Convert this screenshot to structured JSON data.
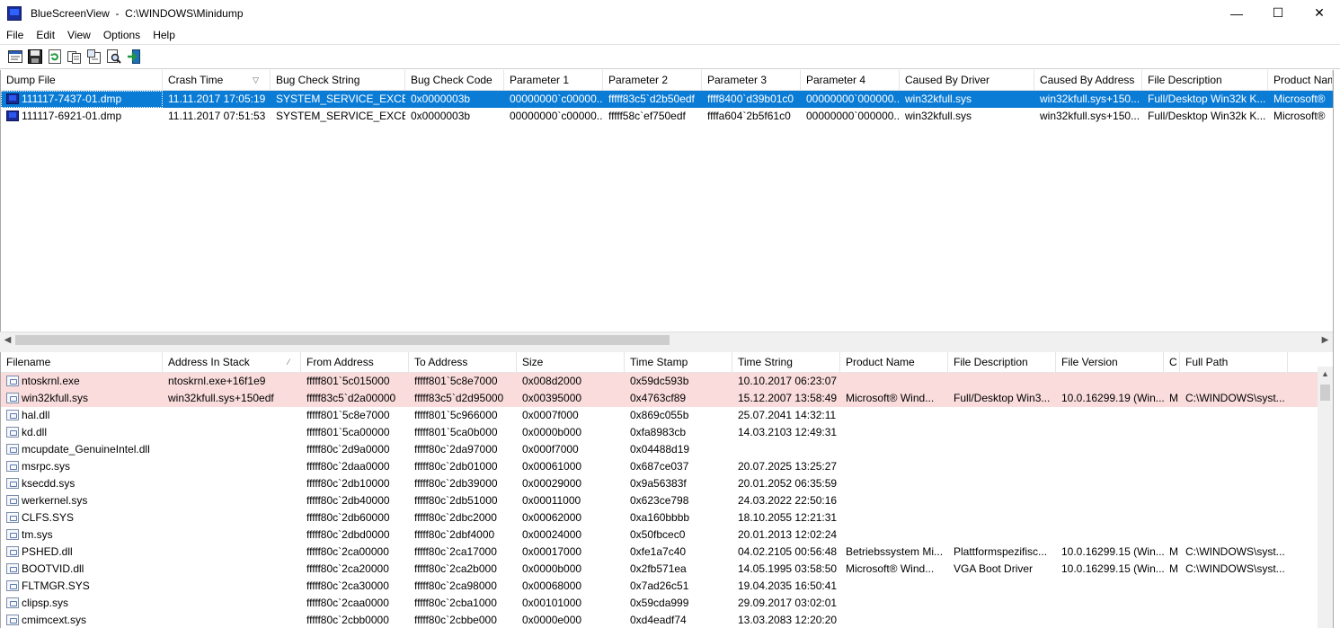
{
  "window": {
    "app_name": "BlueScreenView",
    "title": "BlueScreenView  -  C:\\WINDOWS\\Minidump",
    "minimize": "—",
    "maximize": "☐",
    "close": "✕"
  },
  "menu": [
    "File",
    "Edit",
    "View",
    "Options",
    "Help"
  ],
  "toolbar": {
    "icons": [
      "properties-icon",
      "save-icon",
      "refresh-icon",
      "copy-icon",
      "html-report-icon",
      "find-icon",
      "exit-icon"
    ]
  },
  "dumps": {
    "columns": [
      "Dump File",
      "Crash Time",
      "Bug Check String",
      "Bug Check Code",
      "Parameter 1",
      "Parameter 2",
      "Parameter 3",
      "Parameter 4",
      "Caused By Driver",
      "Caused By Address",
      "File Description",
      "Product Name"
    ],
    "sort_column": "Crash Time",
    "sort_glyph": "▽",
    "rows": [
      [
        "111117-7437-01.dmp",
        "11.11.2017 17:05:19",
        "SYSTEM_SERVICE_EXCE...",
        "0x0000003b",
        "00000000`c00000...",
        "fffff83c5`d2b50edf",
        "ffff8400`d39b01c0",
        "00000000`000000...",
        "win32kfull.sys",
        "win32kfull.sys+150...",
        "Full/Desktop Win32k K...",
        "Microsoft®"
      ],
      [
        "111117-6921-01.dmp",
        "11.11.2017 07:51:53",
        "SYSTEM_SERVICE_EXCE...",
        "0x0000003b",
        "00000000`c00000...",
        "fffff58c`ef750edf",
        "ffffa604`2b5f61c0",
        "00000000`000000...",
        "win32kfull.sys",
        "win32kfull.sys+150...",
        "Full/Desktop Win32k K...",
        "Microsoft®"
      ]
    ],
    "selected_index": 0
  },
  "modules": {
    "columns": [
      "Filename",
      "Address In Stack",
      "From Address",
      "To Address",
      "Size",
      "Time Stamp",
      "Time String",
      "Product Name",
      "File Description",
      "File Version",
      "C",
      "Full Path"
    ],
    "sort_column": "Address In Stack",
    "sort_glyph": "⁄",
    "rows": [
      [
        "ntoskrnl.exe",
        "ntoskrnl.exe+16f1e9",
        "fffff801`5c015000",
        "fffff801`5c8e7000",
        "0x008d2000",
        "0x59dc593b",
        "10.10.2017 06:23:07",
        "",
        "",
        "",
        "",
        ""
      ],
      [
        "win32kfull.sys",
        "win32kfull.sys+150edf",
        "fffff83c5`d2a00000",
        "fffff83c5`d2d95000",
        "0x00395000",
        "0x4763cf89",
        "15.12.2007 13:58:49",
        "Microsoft® Wind...",
        "Full/Desktop Win3...",
        "10.0.16299.19 (Win...",
        "M",
        "C:\\WINDOWS\\syst..."
      ],
      [
        "hal.dll",
        "",
        "fffff801`5c8e7000",
        "fffff801`5c966000",
        "0x0007f000",
        "0x869c055b",
        "25.07.2041 14:32:11",
        "",
        "",
        "",
        "",
        ""
      ],
      [
        "kd.dll",
        "",
        "fffff801`5ca00000",
        "fffff801`5ca0b000",
        "0x0000b000",
        "0xfa8983cb",
        "14.03.2103 12:49:31",
        "",
        "",
        "",
        "",
        ""
      ],
      [
        "mcupdate_GenuineIntel.dll",
        "",
        "fffff80c`2d9a0000",
        "fffff80c`2da97000",
        "0x000f7000",
        "0x04488d19",
        "",
        "",
        "",
        "",
        "",
        ""
      ],
      [
        "msrpc.sys",
        "",
        "fffff80c`2daa0000",
        "fffff80c`2db01000",
        "0x00061000",
        "0x687ce037",
        "20.07.2025 13:25:27",
        "",
        "",
        "",
        "",
        ""
      ],
      [
        "ksecdd.sys",
        "",
        "fffff80c`2db10000",
        "fffff80c`2db39000",
        "0x00029000",
        "0x9a56383f",
        "20.01.2052 06:35:59",
        "",
        "",
        "",
        "",
        ""
      ],
      [
        "werkernel.sys",
        "",
        "fffff80c`2db40000",
        "fffff80c`2db51000",
        "0x00011000",
        "0x623ce798",
        "24.03.2022 22:50:16",
        "",
        "",
        "",
        "",
        ""
      ],
      [
        "CLFS.SYS",
        "",
        "fffff80c`2db60000",
        "fffff80c`2dbc2000",
        "0x00062000",
        "0xa160bbbb",
        "18.10.2055 12:21:31",
        "",
        "",
        "",
        "",
        ""
      ],
      [
        "tm.sys",
        "",
        "fffff80c`2dbd0000",
        "fffff80c`2dbf4000",
        "0x00024000",
        "0x50fbcec0",
        "20.01.2013 12:02:24",
        "",
        "",
        "",
        "",
        ""
      ],
      [
        "PSHED.dll",
        "",
        "fffff80c`2ca00000",
        "fffff80c`2ca17000",
        "0x00017000",
        "0xfe1a7c40",
        "04.02.2105 00:56:48",
        "Betriebssystem Mi...",
        "Plattformspezifisc...",
        "10.0.16299.15 (Win...",
        "M",
        "C:\\WINDOWS\\syst..."
      ],
      [
        "BOOTVID.dll",
        "",
        "fffff80c`2ca20000",
        "fffff80c`2ca2b000",
        "0x0000b000",
        "0x2fb571ea",
        "14.05.1995 03:58:50",
        "Microsoft® Wind...",
        "VGA Boot Driver",
        "10.0.16299.15 (Win...",
        "M",
        "C:\\WINDOWS\\syst..."
      ],
      [
        "FLTMGR.SYS",
        "",
        "fffff80c`2ca30000",
        "fffff80c`2ca98000",
        "0x00068000",
        "0x7ad26c51",
        "19.04.2035 16:50:41",
        "",
        "",
        "",
        "",
        ""
      ],
      [
        "clipsp.sys",
        "",
        "fffff80c`2caa0000",
        "fffff80c`2cba1000",
        "0x00101000",
        "0x59cda999",
        "29.09.2017 03:02:01",
        "",
        "",
        "",
        "",
        ""
      ],
      [
        "cmimcext.sys",
        "",
        "fffff80c`2cbb0000",
        "fffff80c`2cbbe000",
        "0x0000e000",
        "0xd4eadf74",
        "13.03.2083 12:20:20",
        "",
        "",
        "",
        "",
        ""
      ]
    ],
    "highlighted_indices": [
      0,
      1
    ]
  },
  "colors": {
    "selection": "#0a7cd6",
    "highlight_row": "#fadcdc"
  }
}
